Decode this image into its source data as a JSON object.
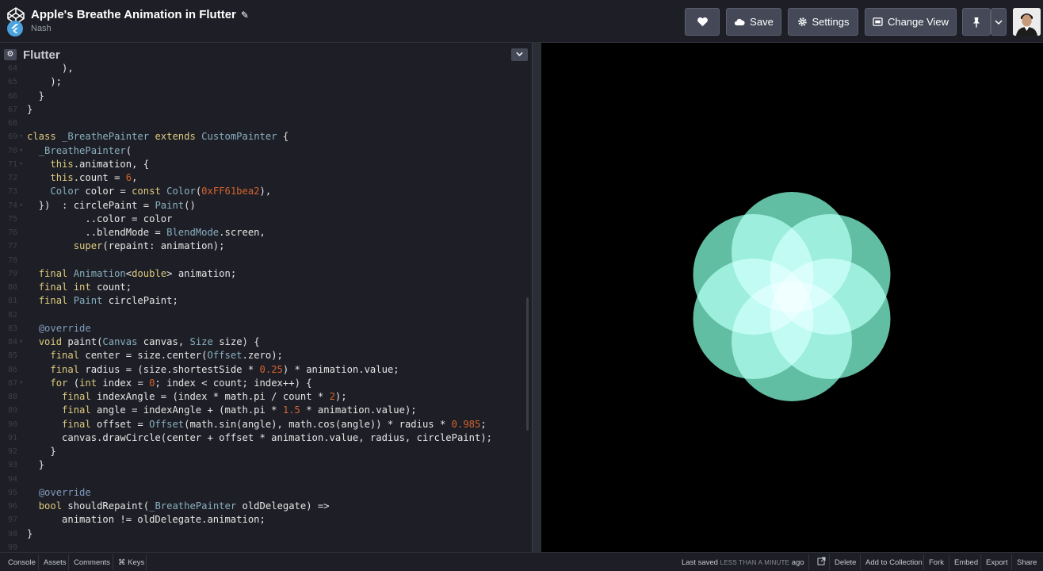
{
  "header": {
    "title": "Apple's Breathe Animation in Flutter",
    "author": "Nash",
    "save_label": "Save",
    "settings_label": "Settings",
    "change_view_label": "Change View"
  },
  "editor": {
    "language": "Flutter",
    "lines": [
      {
        "n": "64",
        "html": "      ),"
      },
      {
        "n": "65",
        "html": "    );"
      },
      {
        "n": "66",
        "html": "  }"
      },
      {
        "n": "67",
        "html": "}"
      },
      {
        "n": "68",
        "html": ""
      },
      {
        "n": "69",
        "fold": true,
        "html": "<span class=\"kw\">class</span> <span class=\"ty\">_BreathePainter</span> <span class=\"kw\">extends</span> <span class=\"ty\">CustomPainter</span> {"
      },
      {
        "n": "70",
        "fold": true,
        "html": "  <span class=\"ty\">_BreathePainter</span>("
      },
      {
        "n": "71",
        "fold": true,
        "html": "    <span class=\"kw\">this</span>.animation, {"
      },
      {
        "n": "72",
        "html": "    <span class=\"kw\">this</span>.count = <span class=\"nu\">6</span>,"
      },
      {
        "n": "73",
        "html": "    <span class=\"ty\">Color</span> color = <span class=\"kw\">const</span> <span class=\"ty\">Color</span>(<span class=\"nu\">0xFF61bea2</span>),"
      },
      {
        "n": "74",
        "fold": true,
        "html": "  })  : circlePaint = <span class=\"ty\">Paint</span>()"
      },
      {
        "n": "75",
        "html": "          ..color = color"
      },
      {
        "n": "76",
        "html": "          ..blendMode = <span class=\"ty\">BlendMode</span>.screen,"
      },
      {
        "n": "77",
        "html": "        <span class=\"kw\">super</span>(repaint: animation);"
      },
      {
        "n": "78",
        "html": ""
      },
      {
        "n": "79",
        "html": "  <span class=\"kw\">final</span> <span class=\"ty\">Animation</span>&lt;<span class=\"kw\">double</span>&gt; animation;"
      },
      {
        "n": "80",
        "html": "  <span class=\"kw\">final</span> <span class=\"kw\">int</span> count;"
      },
      {
        "n": "81",
        "html": "  <span class=\"kw\">final</span> <span class=\"ty\">Paint</span> circlePaint;"
      },
      {
        "n": "82",
        "html": ""
      },
      {
        "n": "83",
        "html": "  <span class=\"an\">@override</span>"
      },
      {
        "n": "84",
        "fold": true,
        "html": "  <span class=\"kw\">void</span> paint(<span class=\"ty\">Canvas</span> canvas, <span class=\"ty\">Size</span> size) {"
      },
      {
        "n": "85",
        "html": "    <span class=\"kw\">final</span> center = size.center(<span class=\"ty\">Offset</span>.zero);"
      },
      {
        "n": "86",
        "html": "    <span class=\"kw\">final</span> radius = (size.shortestSide * <span class=\"nu\">0.25</span>) * animation.value;"
      },
      {
        "n": "87",
        "fold": true,
        "html": "    <span class=\"kw\">for</span> (<span class=\"kw\">int</span> index = <span class=\"nu\">0</span>; index &lt; count; index++) {"
      },
      {
        "n": "88",
        "html": "      <span class=\"kw\">final</span> indexAngle = (index * math.pi / count * <span class=\"nu\">2</span>);"
      },
      {
        "n": "89",
        "html": "      <span class=\"kw\">final</span> angle = indexAngle + (math.pi * <span class=\"nu\">1.5</span> * animation.value);"
      },
      {
        "n": "90",
        "html": "      <span class=\"kw\">final</span> offset = <span class=\"ty\">Offset</span>(math.sin(angle), math.cos(angle)) * radius * <span class=\"nu\">0.985</span>;"
      },
      {
        "n": "91",
        "html": "      canvas.drawCircle(center + offset * animation.value, radius, circlePaint);"
      },
      {
        "n": "92",
        "html": "    }"
      },
      {
        "n": "93",
        "html": "  }"
      },
      {
        "n": "94",
        "html": ""
      },
      {
        "n": "95",
        "html": "  <span class=\"an\">@override</span>"
      },
      {
        "n": "96",
        "html": "  <span class=\"kw\">bool</span> shouldRepaint(<span class=\"ty\">_BreathePainter</span> oldDelegate) =&gt;"
      },
      {
        "n": "97",
        "html": "      animation != oldDelegate.animation;"
      },
      {
        "n": "98",
        "html": "}"
      },
      {
        "n": "99",
        "html": ""
      }
    ]
  },
  "preview": {
    "circle_color": "#61bea2",
    "circle_count": 6
  },
  "footer": {
    "console": "Console",
    "assets": "Assets",
    "comments": "Comments",
    "keys": "⌘ Keys",
    "last_saved_prefix": "Last saved",
    "last_saved_value": "LESS THAN A MINUTE",
    "last_saved_suffix": "ago",
    "delete": "Delete",
    "add_to_collection": "Add to Collection",
    "fork": "Fork",
    "embed": "Embed",
    "export": "Export",
    "share": "Share"
  },
  "colors": {
    "header_bg": "#1e1f26",
    "button_bg": "#444857",
    "preview_bg": "#000000",
    "keyword": "#ddca7e",
    "type": "#88afbf",
    "number": "#d4632e"
  }
}
